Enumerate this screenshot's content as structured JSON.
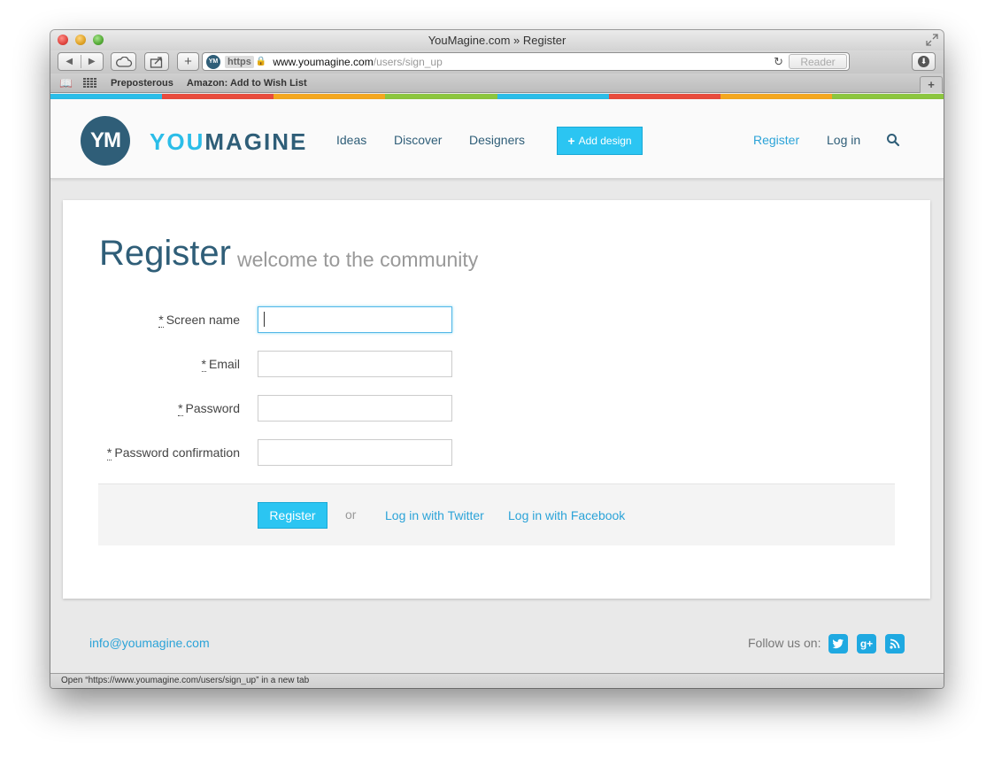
{
  "window": {
    "title": "YouMagine.com » Register"
  },
  "toolbar": {
    "back_icon": "◀",
    "forward_icon": "▶",
    "add_icon": "+",
    "https_label": "https",
    "url_host": "www.youmagine.com",
    "url_path": "/users/sign_up",
    "reader_label": "Reader"
  },
  "bookmarks": {
    "items": [
      "Preposterous",
      "Amazon: Add to Wish List"
    ]
  },
  "site": {
    "color_strip": [
      "#2bbde8",
      "#e84c3d",
      "#f4a71f",
      "#8cc63f",
      "#2bbde8",
      "#e84c3d",
      "#f4a71f",
      "#8cc63f"
    ],
    "logo_initials": "YM",
    "logo_you": "YOU",
    "logo_magine": "MAGINE",
    "nav": {
      "ideas": "Ideas",
      "discover": "Discover",
      "designers": "Designers",
      "add_design": "Add design",
      "register": "Register",
      "login": "Log in"
    }
  },
  "form": {
    "title": "Register",
    "subtitle": "welcome to the community",
    "required_marker": "*",
    "fields": [
      {
        "label": "Screen name",
        "value": ""
      },
      {
        "label": "Email",
        "value": ""
      },
      {
        "label": "Password",
        "value": ""
      },
      {
        "label": "Password confirmation",
        "value": ""
      }
    ],
    "submit_label": "Register",
    "or_text": "or",
    "twitter_link": "Log in with Twitter",
    "facebook_link": "Log in with Facebook"
  },
  "footer": {
    "email": "info@youmagine.com",
    "follow_text": "Follow us on:"
  },
  "status_bar": {
    "text": "Open “https://www.youmagine.com/users/sign_up” in a new tab"
  },
  "colors": {
    "brand_dark": "#2f5e78",
    "brand_cyan": "#2bc5f2",
    "link": "#2ba3d8"
  }
}
